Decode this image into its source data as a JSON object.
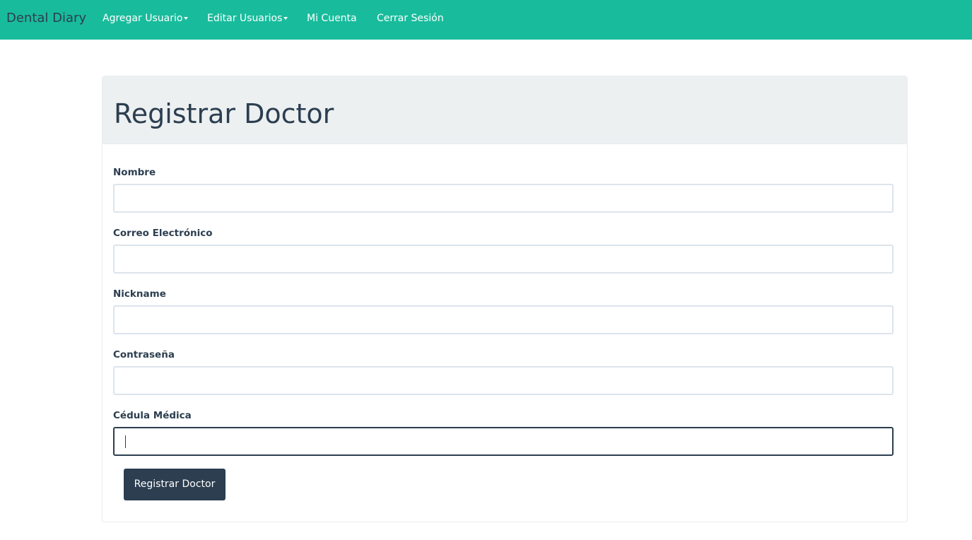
{
  "navbar": {
    "brand": "Dental Diary",
    "items": [
      {
        "label": "Agregar Usuario",
        "dropdown": true
      },
      {
        "label": "Editar Usuarios",
        "dropdown": true
      },
      {
        "label": "Mi Cuenta",
        "dropdown": false
      },
      {
        "label": "Cerrar Sesión",
        "dropdown": false
      }
    ],
    "background_color": "#18bc9c"
  },
  "panel": {
    "title": "Registrar Doctor"
  },
  "form": {
    "fields": [
      {
        "label": "Nombre",
        "value": "",
        "placeholder": ""
      },
      {
        "label": "Correo Electrónico",
        "value": "",
        "placeholder": ""
      },
      {
        "label": "Nickname",
        "value": "",
        "placeholder": ""
      },
      {
        "label": "Contraseña",
        "value": "",
        "placeholder": ""
      },
      {
        "label": "Cédula Médica",
        "value": "",
        "placeholder": "",
        "focused": true
      }
    ],
    "submit_label": "Registrar Doctor"
  },
  "colors": {
    "primary": "#2c3e50",
    "accent": "#18bc9c",
    "panel_heading": "#ecf0f1"
  }
}
